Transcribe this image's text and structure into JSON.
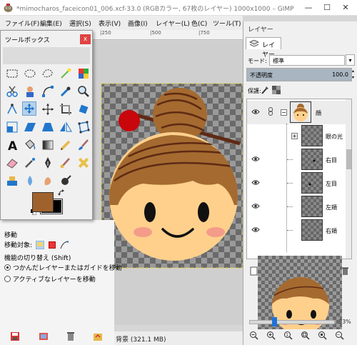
{
  "window": {
    "title": "*mimocharos_faceicon01_006.xcf-33.0 (RGBカラー, 67枚のレイヤー) 1000x1000 – GIMP",
    "minimize": "—",
    "maximize": "☐",
    "close": "✕"
  },
  "menubar": {
    "items": [
      "ファイル(F)",
      "編集(E)",
      "選択(S)",
      "表示(V)",
      "画像(I)",
      "レイヤー(L)",
      "色(C)",
      "ツール(T)"
    ]
  },
  "ruler": {
    "labels": [
      "|250",
      "|500",
      "|750"
    ]
  },
  "toolbox": {
    "title": "ツールボックス",
    "close": "x",
    "tools": [
      "rect-select-icon",
      "ellipse-select-icon",
      "free-select-icon",
      "fuzzy-select-icon",
      "color-select-icon",
      "scissors-select-icon",
      "foreground-select-icon",
      "paths-icon",
      "color-picker-icon",
      "zoom-icon",
      "measure-icon",
      "move-icon",
      "align-icon",
      "crop-icon",
      "rotate-icon",
      "scale-icon",
      "shear-icon",
      "perspective-icon",
      "flip-icon",
      "cage-icon",
      "text-icon",
      "bucket-fill-icon",
      "gradient-icon",
      "pencil-icon",
      "paintbrush-icon",
      "eraser-icon",
      "airbrush-icon",
      "ink-icon",
      "mypaint-brush-icon",
      "heal-icon",
      "clone-icon",
      "blur-icon",
      "smudge-icon",
      "dodge-burn-icon"
    ],
    "active_tool": "move-icon",
    "fg_color": "#a0622d",
    "bg_color": "#000000"
  },
  "tool_options": {
    "title": "移動",
    "target_label": "移動対象:",
    "toggle_label": "機能の切り替え (Shift)",
    "radio_1": "つかんだレイヤーまたはガイドを移動",
    "radio_2": "アクティブなレイヤーを移動"
  },
  "status": {
    "text": "背景 (321.1 MB)"
  },
  "layers_dock": {
    "title": "レイヤー",
    "tab_label": "レイヤー",
    "mode_label": "モード:",
    "mode_value": "標準",
    "opacity_label": "不透明度",
    "opacity_value": "100.0",
    "opacity": 1.0,
    "lock_label": "保護:",
    "layers": [
      {
        "name": "顔",
        "expander": "−"
      },
      {
        "name": "眼の光",
        "expander": "+"
      },
      {
        "name": "右目",
        "expander": ""
      },
      {
        "name": "左目",
        "expander": ""
      },
      {
        "name": "左頬",
        "expander": ""
      },
      {
        "name": "右頬",
        "expander": ""
      }
    ]
  },
  "navigation": {
    "zoom": "33%",
    "zoom_fraction": 0.33
  }
}
